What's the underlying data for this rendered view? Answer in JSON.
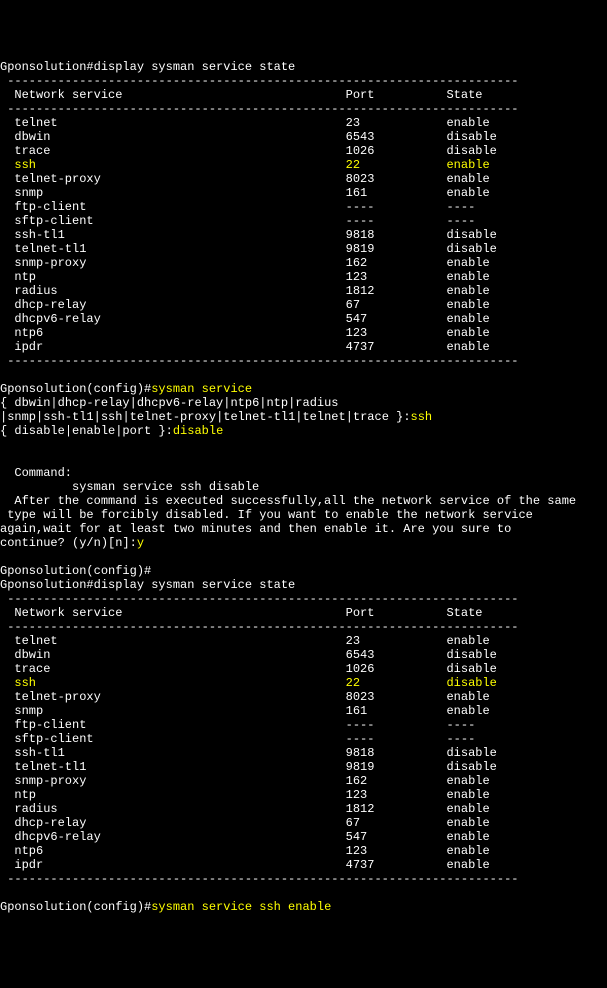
{
  "prompt1_host": "Gponsolution#",
  "cmd_display": "display sysman service state",
  "dash_line": " -----------------------------------------------------------------------",
  "header": {
    "col1": "  Network service",
    "col2": "Port",
    "col3": "State"
  },
  "table1": [
    {
      "name": "telnet",
      "port": "23",
      "state": "enable",
      "hl": false
    },
    {
      "name": "dbwin",
      "port": "6543",
      "state": "disable",
      "hl": false
    },
    {
      "name": "trace",
      "port": "1026",
      "state": "disable",
      "hl": false
    },
    {
      "name": "ssh",
      "port": "22",
      "state": "enable",
      "hl": true
    },
    {
      "name": "telnet-proxy",
      "port": "8023",
      "state": "enable",
      "hl": false
    },
    {
      "name": "snmp",
      "port": "161",
      "state": "enable",
      "hl": false
    },
    {
      "name": "ftp-client",
      "port": "----",
      "state": "----",
      "hl": false
    },
    {
      "name": "sftp-client",
      "port": "----",
      "state": "----",
      "hl": false
    },
    {
      "name": "ssh-tl1",
      "port": "9818",
      "state": "disable",
      "hl": false
    },
    {
      "name": "telnet-tl1",
      "port": "9819",
      "state": "disable",
      "hl": false
    },
    {
      "name": "snmp-proxy",
      "port": "162",
      "state": "enable",
      "hl": false
    },
    {
      "name": "ntp",
      "port": "123",
      "state": "enable",
      "hl": false
    },
    {
      "name": "radius",
      "port": "1812",
      "state": "enable",
      "hl": false
    },
    {
      "name": "dhcp-relay",
      "port": "67",
      "state": "enable",
      "hl": false
    },
    {
      "name": "dhcpv6-relay",
      "port": "547",
      "state": "enable",
      "hl": false
    },
    {
      "name": "ntp6",
      "port": "123",
      "state": "enable",
      "hl": false
    },
    {
      "name": "ipdr",
      "port": "4737",
      "state": "enable",
      "hl": false
    }
  ],
  "prompt2_host": "Gponsolution(config)#",
  "cmd_sysman": "sysman service",
  "choice1": "{ dbwin<K>|dhcp-relay<K>|dhcpv6-relay<K>|ntp6<K>|ntp<K>|radius<K>",
  "choice2a": "|snmp<K>|ssh-tl1<K>|ssh<K>|telnet-proxy<K>|telnet-tl1<K>|telnet<K>|trace<K> }:",
  "choice2b": "ssh",
  "choice3a": "{ disable<K>|enable<K>|port<K> }:",
  "choice3b": "disable",
  "cmd_label": "  Command:",
  "cmd_line": "          sysman service ssh disable",
  "warn1": "  After the command is executed successfully,all the network service of the same",
  "warn2": " type will be forcibly disabled. If you want to enable the network service",
  "warn3": "again,wait for at least two minutes and then enable it. Are you sure to",
  "warn4a": "continue? (y/n)[n]:",
  "warn4b": "y",
  "table2": [
    {
      "name": "telnet",
      "port": "23",
      "state": "enable",
      "hl": false
    },
    {
      "name": "dbwin",
      "port": "6543",
      "state": "disable",
      "hl": false
    },
    {
      "name": "trace",
      "port": "1026",
      "state": "disable",
      "hl": false
    },
    {
      "name": "ssh",
      "port": "22",
      "state": "disable",
      "hl": true
    },
    {
      "name": "telnet-proxy",
      "port": "8023",
      "state": "enable",
      "hl": false
    },
    {
      "name": "snmp",
      "port": "161",
      "state": "enable",
      "hl": false
    },
    {
      "name": "ftp-client",
      "port": "----",
      "state": "----",
      "hl": false
    },
    {
      "name": "sftp-client",
      "port": "----",
      "state": "----",
      "hl": false
    },
    {
      "name": "ssh-tl1",
      "port": "9818",
      "state": "disable",
      "hl": false
    },
    {
      "name": "telnet-tl1",
      "port": "9819",
      "state": "disable",
      "hl": false
    },
    {
      "name": "snmp-proxy",
      "port": "162",
      "state": "enable",
      "hl": false
    },
    {
      "name": "ntp",
      "port": "123",
      "state": "enable",
      "hl": false
    },
    {
      "name": "radius",
      "port": "1812",
      "state": "enable",
      "hl": false
    },
    {
      "name": "dhcp-relay",
      "port": "67",
      "state": "enable",
      "hl": false
    },
    {
      "name": "dhcpv6-relay",
      "port": "547",
      "state": "enable",
      "hl": false
    },
    {
      "name": "ntp6",
      "port": "123",
      "state": "enable",
      "hl": false
    },
    {
      "name": "ipdr",
      "port": "4737",
      "state": "enable",
      "hl": false
    }
  ],
  "cmd_enable": "sysman service ssh enable"
}
